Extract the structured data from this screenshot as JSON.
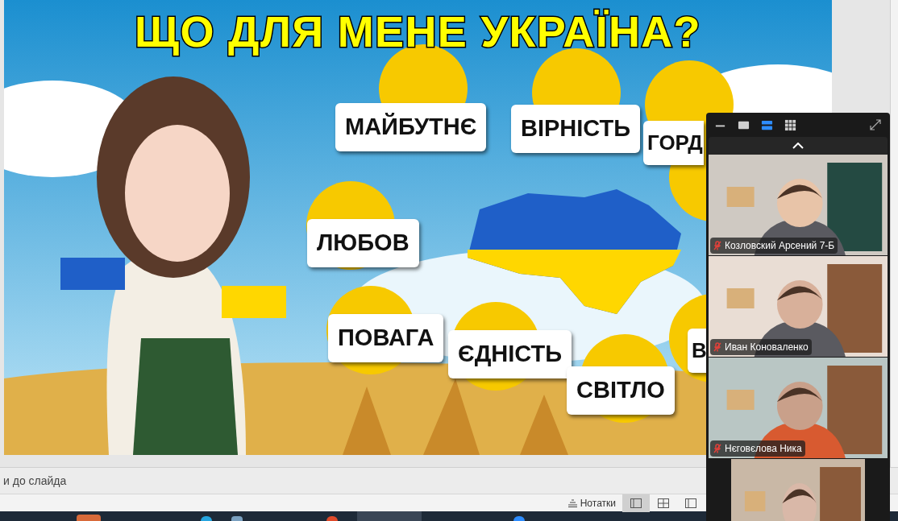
{
  "slide": {
    "title": "ЩО ДЛЯ МЕНЕ УКРАЇНА?",
    "words": [
      {
        "text": "МАЙБУТНЄ"
      },
      {
        "text": "ВІРНІСТЬ"
      },
      {
        "text": "ГОРД"
      },
      {
        "text": "ЛЮБОВ"
      },
      {
        "text": "ПОВАГА"
      },
      {
        "text": "ЄДНІСТЬ"
      },
      {
        "text": "СВІТЛО"
      },
      {
        "text": "В"
      }
    ]
  },
  "notes": {
    "text": "и до слайда"
  },
  "status_bar": {
    "notes_button": "Нотатки",
    "views": [
      {
        "selected": true
      },
      {
        "selected": false
      },
      {
        "selected": false
      }
    ]
  },
  "video_panel": {
    "layouts": [
      {
        "selected": false
      },
      {
        "selected": false
      },
      {
        "selected": true
      },
      {
        "selected": false
      }
    ],
    "participants": [
      {
        "name": "Козловский Арсений 7-Б",
        "muted": true
      },
      {
        "name": "Иван Коноваленко",
        "muted": true
      },
      {
        "name": "Нєговєлова Ника",
        "muted": true
      },
      {
        "muted": false
      }
    ]
  }
}
